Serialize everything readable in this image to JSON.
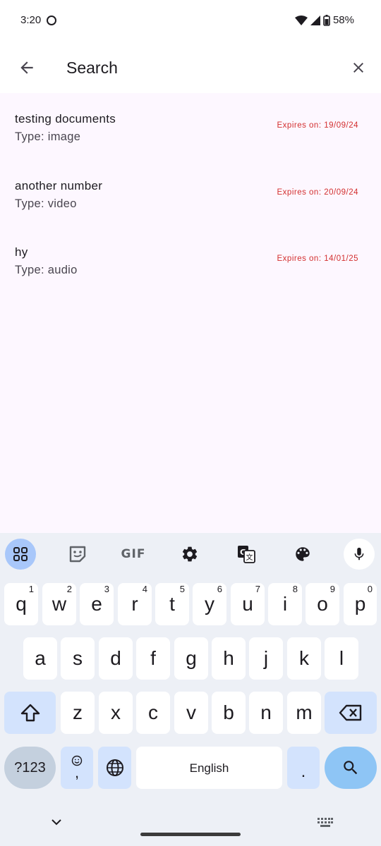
{
  "status_bar": {
    "time": "3:20",
    "battery": "58%"
  },
  "search": {
    "placeholder": "Search",
    "value": ""
  },
  "documents": [
    {
      "title": "testing documents",
      "type": "Type: image",
      "expiry": "Expires on: 19/09/24"
    },
    {
      "title": "another number",
      "type": "Type: video",
      "expiry": "Expires on: 20/09/24"
    },
    {
      "title": "hy",
      "type": "Type: audio",
      "expiry": "Expires on: 14/01/25"
    }
  ],
  "keyboard": {
    "toolbar": {
      "gif": "GIF"
    },
    "row1": [
      {
        "key": "q",
        "hint": "1"
      },
      {
        "key": "w",
        "hint": "2"
      },
      {
        "key": "e",
        "hint": "3"
      },
      {
        "key": "r",
        "hint": "4"
      },
      {
        "key": "t",
        "hint": "5"
      },
      {
        "key": "y",
        "hint": "6"
      },
      {
        "key": "u",
        "hint": "7"
      },
      {
        "key": "i",
        "hint": "8"
      },
      {
        "key": "o",
        "hint": "9"
      },
      {
        "key": "p",
        "hint": "0"
      }
    ],
    "row2": [
      "a",
      "s",
      "d",
      "f",
      "g",
      "h",
      "j",
      "k",
      "l"
    ],
    "row3": [
      "z",
      "x",
      "c",
      "v",
      "b",
      "n",
      "m"
    ],
    "symbols_label": "?123",
    "comma_label": ",",
    "space_label": "English",
    "period_label": "."
  },
  "colors": {
    "accent": "#d32f2f",
    "background": "#fdf7ff",
    "keyboard": "#edf0f6"
  }
}
